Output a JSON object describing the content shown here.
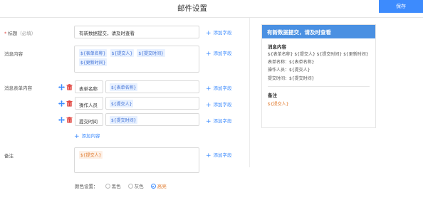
{
  "header": {
    "title": "邮件设置",
    "save_label": "保存"
  },
  "form": {
    "title_label": "标题",
    "title_required": "*",
    "title_hint": "（必填）",
    "title_value": "有新数据提交，请及时查看",
    "message_label": "消息内容",
    "message_tags": [
      "${表单名称}",
      "${提交人}",
      "${提交时间}",
      "${更新时间}"
    ],
    "message_form_label": "消息表单内容",
    "rows": [
      {
        "key": "表单名称",
        "value": "${表单名称}"
      },
      {
        "key": "操作人员",
        "value": "${提交人}"
      },
      {
        "key": "提交时间",
        "value": "${提交时间}"
      }
    ],
    "add_content_label": "添加内容",
    "remark_label": "备注",
    "remark_tag": "${提交人}",
    "add_field_label": "添加字段",
    "color_label": "颜色设置：",
    "color_options": [
      "黑色",
      "灰色",
      "高亮"
    ],
    "color_selected": "高亮",
    "accent": "#3d8bfd",
    "highlight": "#e07a2d"
  },
  "preview": {
    "title": "有新数据提交，请及时查看",
    "message_heading": "消息内容",
    "message_text": "${表单名称} ${提交人} ${提交时间} ${更新时间}",
    "lines": [
      {
        "key": "表单名称：",
        "value": "${表单名称}"
      },
      {
        "key": "操作人员：",
        "value": "${提交人}"
      },
      {
        "key": "提交时间：",
        "value": "${提交时间}"
      }
    ],
    "remark_heading": "备注",
    "remark_text": "${提交人}"
  }
}
